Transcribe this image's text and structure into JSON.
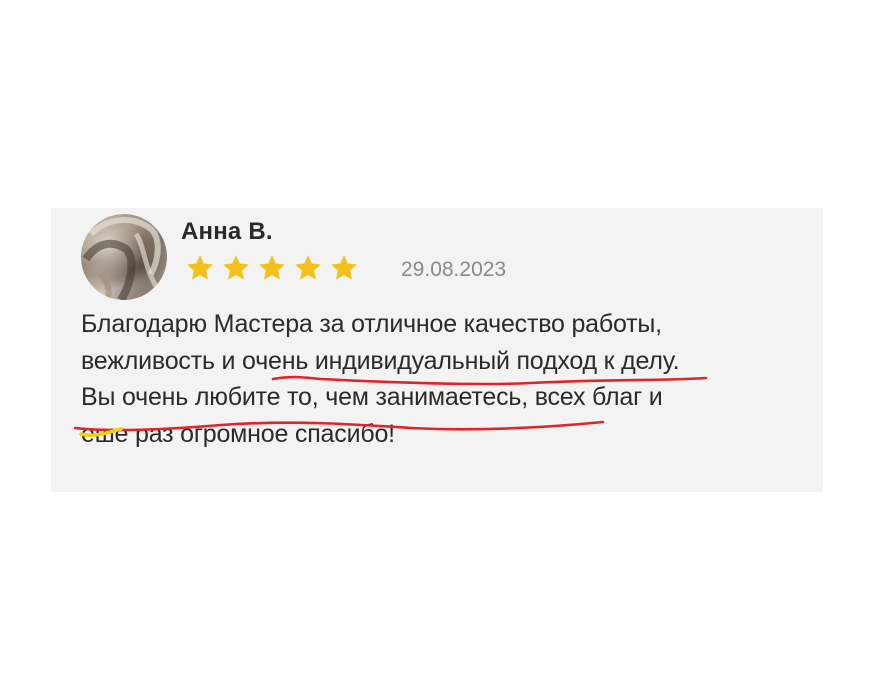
{
  "review": {
    "author": "Анна В.",
    "rating": 5,
    "rating_max": 5,
    "date": "29.08.2023",
    "lines": [
      "Благодарю Мастера за отличное качество работы,",
      "вежливость и очень индивидуальный подход к делу.",
      "Вы очень любите то, чем занимаетесь, всех благ и",
      "еше раз огромное спасибо!"
    ]
  },
  "colors": {
    "star": "#f2c21b",
    "underline": "#e0242a",
    "highlight": "#f5d000",
    "card": "#f3f3f3"
  },
  "icons": {
    "star": "star-icon",
    "avatar": "avatar"
  }
}
